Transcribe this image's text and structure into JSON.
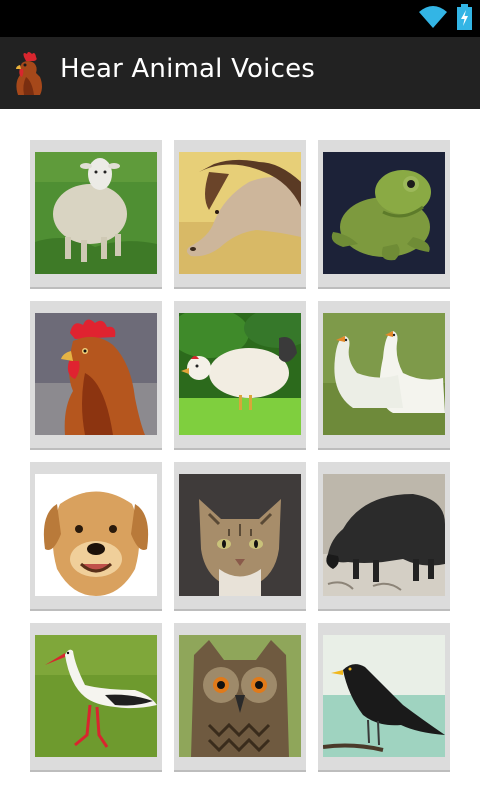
{
  "app": {
    "title": "Hear Animal Voices",
    "icon": "rooster-icon"
  },
  "status_bar": {
    "icons": [
      "wifi-icon",
      "battery-charging-icon"
    ],
    "accent_color": "#33b5e5"
  },
  "grid": {
    "items": [
      {
        "animal": "sheep"
      },
      {
        "animal": "horse"
      },
      {
        "animal": "frog"
      },
      {
        "animal": "rooster"
      },
      {
        "animal": "chicken"
      },
      {
        "animal": "geese"
      },
      {
        "animal": "dog"
      },
      {
        "animal": "cat"
      },
      {
        "animal": "boar"
      },
      {
        "animal": "stork"
      },
      {
        "animal": "owl"
      },
      {
        "animal": "blackbird"
      }
    ]
  }
}
